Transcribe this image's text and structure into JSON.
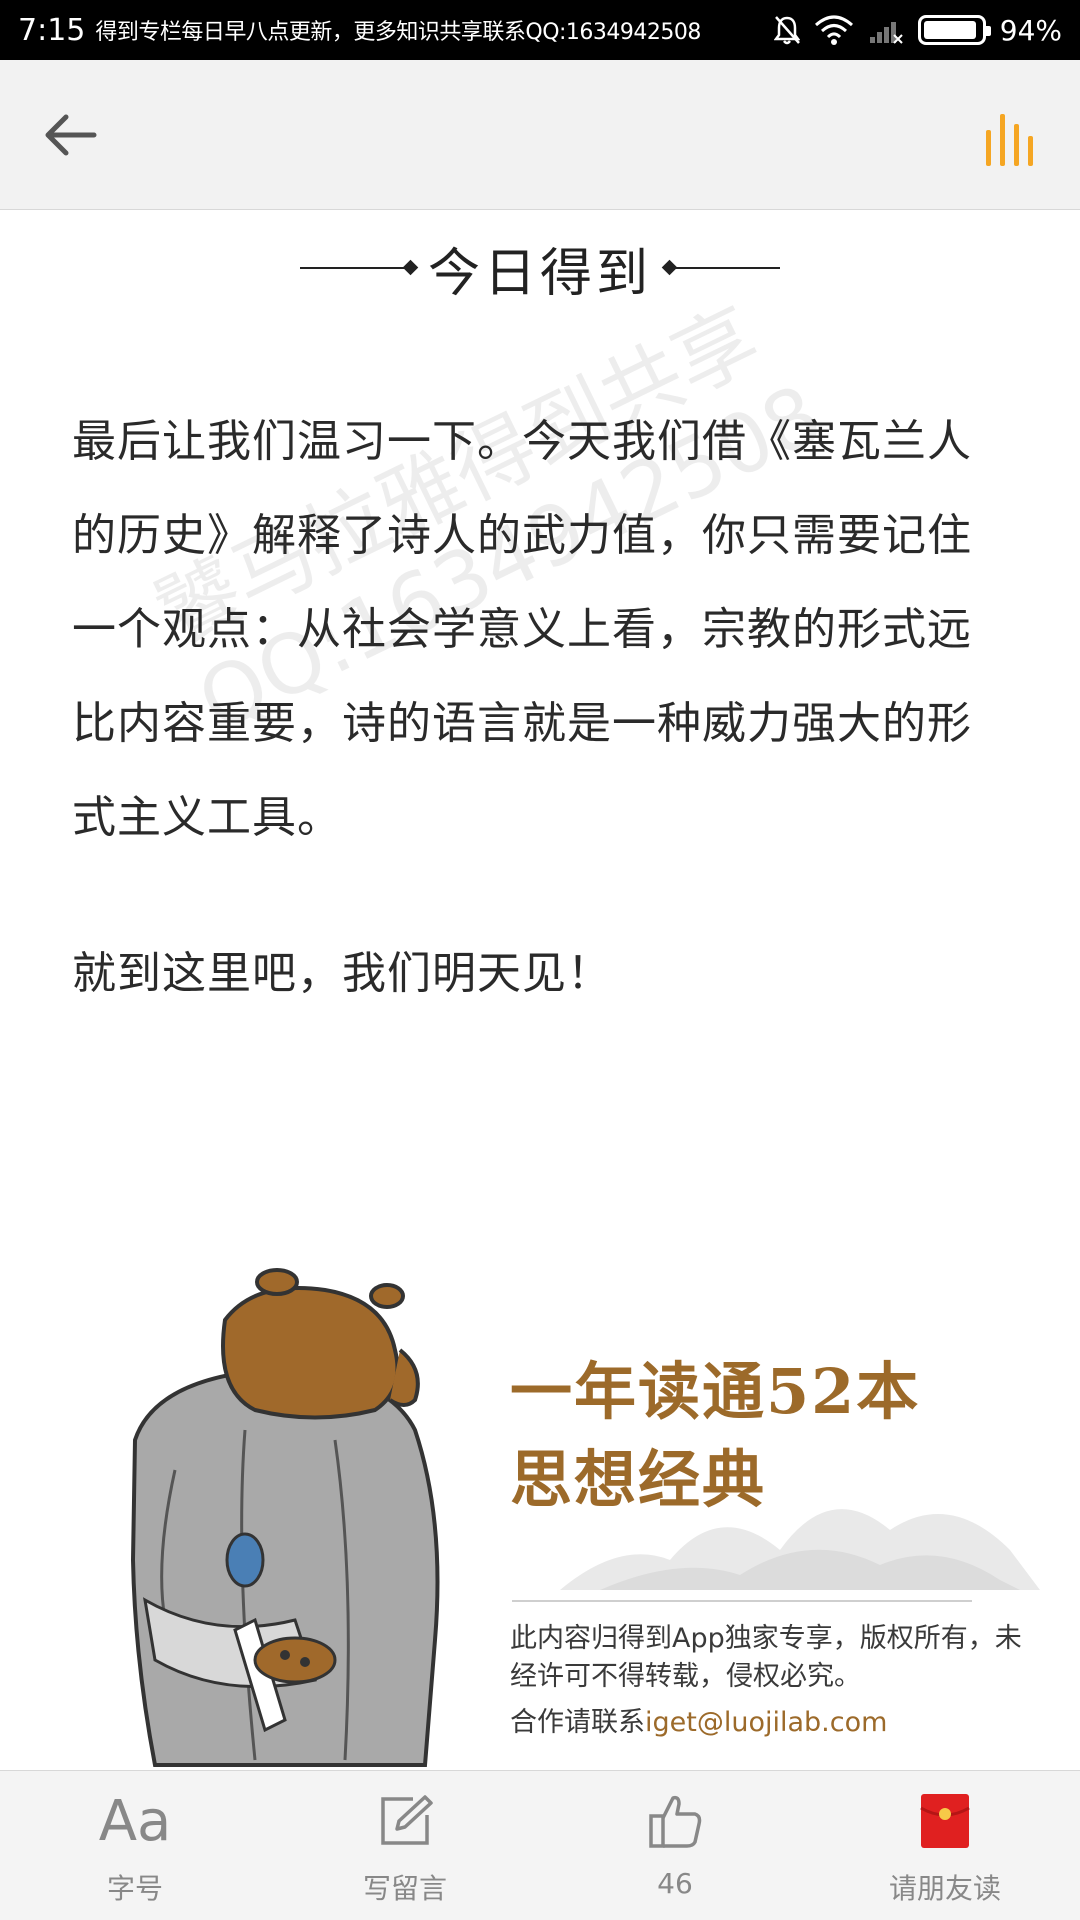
{
  "status_bar": {
    "time": "7:15",
    "notice": "得到专栏每日早八点更新，更多知识共享联系QQ:1634942508",
    "battery": "94%",
    "battery_level": 0.94,
    "icons": [
      "bell-off-icon",
      "wifi-icon",
      "signal-icon",
      "battery-icon"
    ]
  },
  "header": {
    "back_icon": "back-arrow-icon",
    "audio_icon": "audio-bars-icon",
    "accent_color": "#f5a623"
  },
  "section": {
    "title": "今日得到"
  },
  "article": {
    "paragraphs": [
      "最后让我们温习一下。今天我们借《塞瓦兰人的历史》解释了诗人的武力值，你只需要记住一个观点：从社会学意义上看，宗教的形式远比内容重要，诗的语言就是一种威力强大的形式主义工具。",
      "就到这里吧，我们明天见！"
    ]
  },
  "watermark": {
    "line1": "饕马拉雅得到共享",
    "line2": "QQ:1634942508"
  },
  "banner": {
    "heading_line1": "一年读通52本",
    "heading_line2": "思想经典",
    "copyright": "此内容归得到App独家专享，版权所有，未经许可不得转载，侵权必究。",
    "contact_prefix": "合作请联系",
    "contact_email": "iget@luojilab.com",
    "accent_color": "#9c6a2a"
  },
  "bottom_bar": {
    "tabs": [
      {
        "icon": "font-size-icon",
        "glyph": "Aa",
        "label": "字号"
      },
      {
        "icon": "edit-comment-icon",
        "label": "写留言"
      },
      {
        "icon": "thumbs-up-icon",
        "label": "46"
      },
      {
        "icon": "red-envelope-icon",
        "label": "请朋友读"
      }
    ]
  }
}
